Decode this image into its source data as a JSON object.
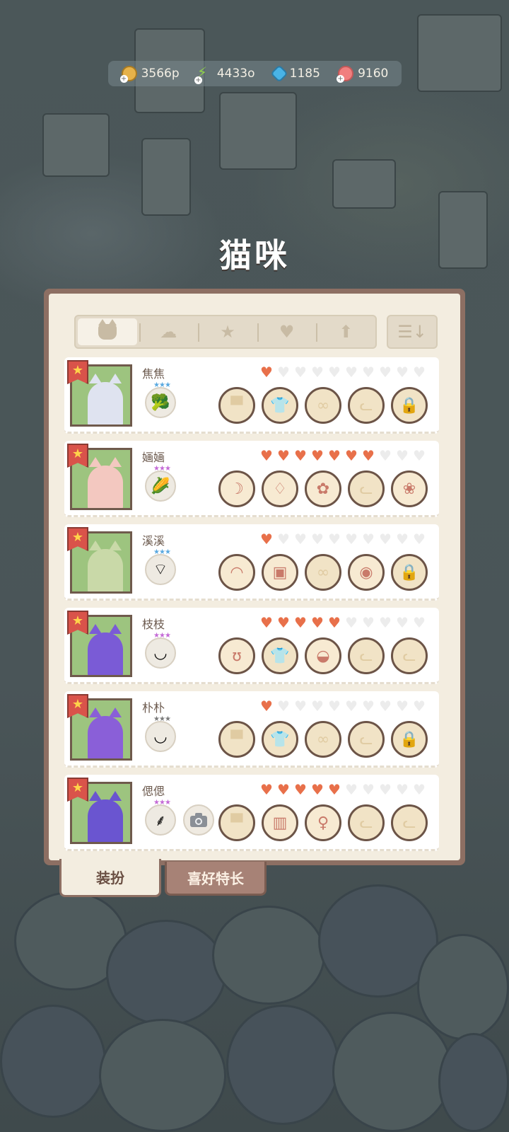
{
  "currencies": [
    {
      "icon": "coin-icon",
      "value": "3566p"
    },
    {
      "icon": "energy-bolt-icon",
      "value": "4433o"
    },
    {
      "icon": "diamond-icon",
      "value": "1185"
    },
    {
      "icon": "yarn-ball-icon",
      "value": "9160"
    }
  ],
  "title": "猫咪",
  "filter_tabs": [
    {
      "icon": "cat-icon",
      "active": true
    },
    {
      "icon": "chef-hat-icon",
      "active": false
    },
    {
      "icon": "star-icon",
      "active": false
    },
    {
      "icon": "heart-icon",
      "active": false
    },
    {
      "icon": "arrow-up-icon",
      "active": false
    }
  ],
  "sort_icon": "sort-icon",
  "cats": [
    {
      "name": "焦焦",
      "hearts": 1,
      "max_hearts": 10,
      "skill_icon": "broccoli-icon",
      "skill_star_color": "#5aa9e0",
      "has_camera": false,
      "fur": "#dfe3f0",
      "slots": [
        "hat-slot-icon",
        "shirt-slot-icon",
        "glasses-slot-icon",
        "cat-face-slot-icon",
        "lock-icon"
      ]
    },
    {
      "name": "婳婳",
      "hearts": 7,
      "max_hearts": 10,
      "skill_icon": "corn-icon",
      "skill_star_color": "#c46ad6",
      "has_camera": false,
      "fur": "#f3c8c0",
      "slots": [
        "crescent-hairpin-icon",
        "pink-dress-icon",
        "paw-print-icon",
        "cat-face-slot-icon",
        "pink-squirrel-icon"
      ]
    },
    {
      "name": "溪溪",
      "hearts": 1,
      "max_hearts": 10,
      "skill_icon": "radish-icon",
      "skill_star_color": "#5aa9e0",
      "has_camera": false,
      "fur": "#c9d9a8",
      "slots": [
        "cap-icon",
        "vest-icon",
        "glasses-slot-icon",
        "raccoon-icon",
        "lock-icon"
      ]
    },
    {
      "name": "枝枝",
      "hearts": 5,
      "max_hearts": 10,
      "skill_icon": "noodle-bowl-icon",
      "skill_star_color": "#c46ad6",
      "has_camera": false,
      "fur": "#7a5bd6",
      "slots": [
        "ear-clip-icon",
        "shirt-slot-icon",
        "green-hat-icon",
        "cat-face-slot-icon",
        "cat-face-slot-icon"
      ]
    },
    {
      "name": "朴朴",
      "hearts": 1,
      "max_hearts": 10,
      "skill_icon": "rice-bowl-icon",
      "skill_star_color": "#7a7a7a",
      "has_camera": false,
      "fur": "#8a5fd8",
      "slots": [
        "hat-slot-icon",
        "shirt-slot-icon",
        "glasses-slot-icon",
        "cat-face-slot-icon",
        "lock-icon"
      ]
    },
    {
      "name": "偲偲",
      "hearts": 5,
      "max_hearts": 10,
      "skill_icon": "wheat-icon",
      "skill_star_color": "#c46ad6",
      "has_camera": true,
      "fur": "#6a55d0",
      "slots": [
        "hat-slot-icon",
        "red-overalls-icon",
        "cotton-candy-icon",
        "cat-face-slot-icon",
        "cat-face-slot-icon"
      ]
    }
  ],
  "bottom_tabs": {
    "outfit": "装扮",
    "hobby": "喜好特长"
  }
}
